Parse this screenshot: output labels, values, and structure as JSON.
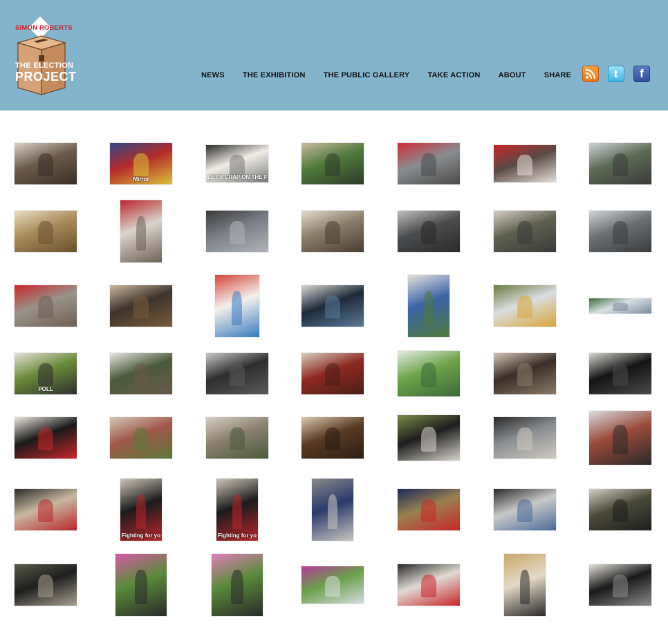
{
  "logo": {
    "top_text": "SIMON ROBERTS",
    "line1": "THE ELECTION",
    "line2": "PROJECT",
    "colors": {
      "red": "#c9202f",
      "box": "#d5a277",
      "box_dark": "#8a5a35"
    }
  },
  "nav": {
    "items": [
      {
        "label": "NEWS"
      },
      {
        "label": "THE EXHIBITION"
      },
      {
        "label": "THE PUBLIC GALLERY"
      },
      {
        "label": "TAKE ACTION"
      },
      {
        "label": "ABOUT"
      },
      {
        "label": "SHARE"
      }
    ]
  },
  "social": [
    {
      "name": "rss-icon",
      "glyph": ""
    },
    {
      "name": "twitter-icon",
      "glyph": "t"
    },
    {
      "name": "facebook-icon",
      "glyph": "f"
    }
  ],
  "colors": {
    "header_bg": "#84b4cb",
    "page_bg": "#ffffff",
    "nav_text": "#111111"
  },
  "gallery": {
    "rows": [
      [
        {
          "shape": "landscape",
          "colors": [
            "#6b5a4a",
            "#d8d2c8",
            "#3a2e26"
          ]
        },
        {
          "shape": "landscape",
          "colors": [
            "#b42a2a",
            "#2e4a86",
            "#d9c23a"
          ],
          "text": "Mirror"
        },
        {
          "shape": "landscape-short",
          "colors": [
            "#f0ede6",
            "#2b2b2b",
            "#7a7a7a"
          ],
          "text": "LET'S CRAP ON THE POOR"
        },
        {
          "shape": "landscape",
          "colors": [
            "#4f7a3a",
            "#c9b9a0",
            "#2e3a2a"
          ]
        },
        {
          "shape": "landscape",
          "colors": [
            "#8a8d90",
            "#cf2b3a",
            "#4a4a4a"
          ]
        },
        {
          "shape": "landscape-short",
          "colors": [
            "#5a4a44",
            "#c8262a",
            "#e6e0da"
          ]
        },
        {
          "shape": "landscape",
          "colors": [
            "#5c6a54",
            "#cdd1d6",
            "#3a3a3a"
          ]
        }
      ],
      [
        {
          "shape": "landscape",
          "colors": [
            "#a88a5a",
            "#e9dec4",
            "#6a5030"
          ]
        },
        {
          "shape": "portrait",
          "colors": [
            "#d9d4cc",
            "#b9262c",
            "#6d6157"
          ]
        },
        {
          "shape": "landscape",
          "colors": [
            "#7a7f86",
            "#3a3a3a",
            "#b0b4b8"
          ]
        },
        {
          "shape": "landscape",
          "colors": [
            "#8a7d6a",
            "#e3dbcf",
            "#4a3e32"
          ]
        },
        {
          "shape": "landscape",
          "colors": [
            "#4a4c4e",
            "#c0bfbd",
            "#2a2a2a"
          ]
        },
        {
          "shape": "landscape",
          "colors": [
            "#5f6050",
            "#d6d0c6",
            "#3a3a3a"
          ]
        },
        {
          "shape": "landscape",
          "colors": [
            "#6b6f72",
            "#d2d4d6",
            "#3a3c3e"
          ]
        }
      ],
      [
        {
          "shape": "landscape",
          "colors": [
            "#9a938a",
            "#c8262a",
            "#6d5f54"
          ]
        },
        {
          "shape": "landscape",
          "colors": [
            "#3e342c",
            "#c9b7a0",
            "#7a5a3c"
          ]
        },
        {
          "shape": "portrait-chart",
          "colors": [
            "#f3f1ec",
            "#d5453a",
            "#3a7abf"
          ]
        },
        {
          "shape": "landscape",
          "colors": [
            "#1e2a3a",
            "#d9d6d0",
            "#5a7a9a"
          ]
        },
        {
          "shape": "portrait",
          "colors": [
            "#3b63a8",
            "#e4e1da",
            "#4f7a3a"
          ]
        },
        {
          "shape": "landscape",
          "colors": [
            "#d9dde0",
            "#6b7a3e",
            "#d9a53a"
          ]
        },
        {
          "shape": "banner",
          "colors": [
            "#d9e0e4",
            "#3c6b3a",
            "#7a8a9a"
          ]
        }
      ],
      [
        {
          "shape": "landscape",
          "colors": [
            "#6a8a3a",
            "#e6e2da",
            "#2e2e2e"
          ],
          "text": "POLL"
        },
        {
          "shape": "landscape",
          "colors": [
            "#4a5a3a",
            "#e6e6e0",
            "#6a5a4a"
          ]
        },
        {
          "shape": "landscape",
          "colors": [
            "#2e2e2e",
            "#c9c9c9",
            "#5a5a5a"
          ]
        },
        {
          "shape": "landscape",
          "colors": [
            "#8e2a22",
            "#d8cfc0",
            "#4a1e1a"
          ]
        },
        {
          "shape": "landscape-tall",
          "colors": [
            "#6ea34a",
            "#e3ece3",
            "#3a6a3a"
          ]
        },
        {
          "shape": "landscape",
          "colors": [
            "#3a2e26",
            "#cfc6b8",
            "#8a7a6a"
          ]
        },
        {
          "shape": "landscape",
          "colors": [
            "#141414",
            "#d8d6d0",
            "#4a4a4a"
          ]
        }
      ],
      [
        {
          "shape": "landscape",
          "colors": [
            "#1a1a1a",
            "#ece8e0",
            "#c8262a"
          ]
        },
        {
          "shape": "landscape",
          "colors": [
            "#a0574a",
            "#d3c8b8",
            "#5a7a3a"
          ]
        },
        {
          "shape": "landscape",
          "colors": [
            "#8a8070",
            "#d6d0c4",
            "#4a5a3a"
          ]
        },
        {
          "shape": "landscape",
          "colors": [
            "#5a3a22",
            "#d8cab0",
            "#2a1e14"
          ]
        },
        {
          "shape": "landscape-tall",
          "colors": [
            "#1e1e1e",
            "#7a8a4a",
            "#d8d4cc"
          ]
        },
        {
          "shape": "landscape",
          "colors": [
            "#8a8e92",
            "#2a2a2a",
            "#cfc9c0"
          ]
        },
        {
          "shape": "landscape-xtall",
          "colors": [
            "#9a4a3a",
            "#d9dcdf",
            "#2a2a2a"
          ]
        }
      ],
      [
        {
          "shape": "landscape",
          "colors": [
            "#c8b8a0",
            "#2a2a2a",
            "#b9262c"
          ]
        },
        {
          "shape": "portrait",
          "colors": [
            "#1c1c1c",
            "#cfc6ba",
            "#b9262c"
          ],
          "text": "Fighting for you"
        },
        {
          "shape": "portrait",
          "colors": [
            "#1c1c1c",
            "#cfc6ba",
            "#b9262c"
          ],
          "text": "Fighting for you"
        },
        {
          "shape": "portrait",
          "colors": [
            "#2a3a6a",
            "#8a8a8a",
            "#c9c6c0"
          ]
        },
        {
          "shape": "landscape",
          "colors": [
            "#9a8050",
            "#1a2a5a",
            "#c8262a"
          ]
        },
        {
          "shape": "landscape",
          "colors": [
            "#c9c9c9",
            "#2a2a2a",
            "#4a6a9a"
          ]
        },
        {
          "shape": "landscape",
          "colors": [
            "#4a4a3a",
            "#d3cfc4",
            "#1e1e1e"
          ]
        }
      ],
      [
        {
          "shape": "landscape",
          "colors": [
            "#1e1e1e",
            "#5a5a4a",
            "#a8a090"
          ]
        },
        {
          "shape": "portrait-wide",
          "colors": [
            "#5a8a3a",
            "#d65aa8",
            "#2a2a2a"
          ]
        },
        {
          "shape": "portrait-wide",
          "colors": [
            "#5a8a3a",
            "#e27fbd",
            "#2a2a2a"
          ]
        },
        {
          "shape": "landscape-short",
          "colors": [
            "#6aa04a",
            "#b43a9a",
            "#d7dce0"
          ]
        },
        {
          "shape": "landscape",
          "colors": [
            "#e0dad4",
            "#2a2a2a",
            "#c8262a"
          ]
        },
        {
          "shape": "portrait",
          "colors": [
            "#e3d9c6",
            "#c9a86a",
            "#2a2a2a"
          ]
        },
        {
          "shape": "landscape",
          "colors": [
            "#1a1a1a",
            "#e6e2dc",
            "#8a8a8a"
          ]
        }
      ]
    ]
  }
}
